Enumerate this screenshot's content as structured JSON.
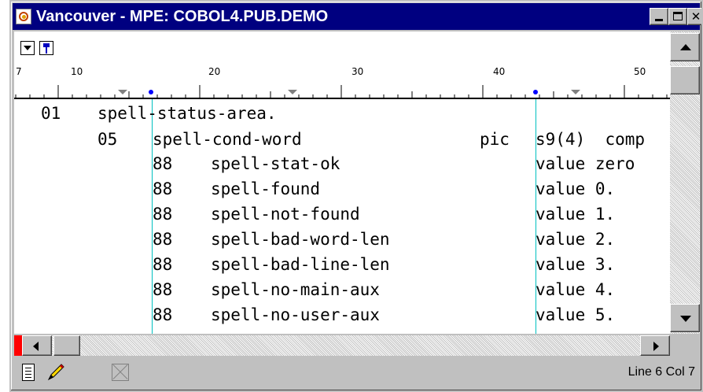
{
  "window": {
    "title": "Vancouver - MPE: COBOL4.PUB.DEMO",
    "controls": {
      "minimize_icon": "minimize-icon",
      "maximize_icon": "maximize-icon",
      "close_glyph": "✕"
    }
  },
  "toolbar": {
    "dropdown_icon": "dropdown-arrow-icon",
    "pin_icon": "pin-icon"
  },
  "ruler": {
    "labels": [
      "7",
      "10",
      "20",
      "30",
      "40",
      "50"
    ],
    "marker_colors": {
      "tab_stop": "#808080",
      "margin": "#0000ff"
    }
  },
  "code": {
    "lines": [
      {
        "level": "01",
        "name": "spell-status-area.",
        "clause": "",
        "value": ""
      },
      {
        "level": "05",
        "name": "spell-cond-word",
        "clause": "pic",
        "value": "s9(4)  comp"
      },
      {
        "level": "88",
        "name": "spell-stat-ok",
        "clause": "",
        "value": "value zero"
      },
      {
        "level": "88",
        "name": "spell-found",
        "clause": "",
        "value": "value 0."
      },
      {
        "level": "88",
        "name": "spell-not-found",
        "clause": "",
        "value": "value 1."
      },
      {
        "level": "88",
        "name": "spell-bad-word-len",
        "clause": "",
        "value": "value 2."
      },
      {
        "level": "88",
        "name": "spell-bad-line-len",
        "clause": "",
        "value": "value 3."
      },
      {
        "level": "88",
        "name": "spell-no-main-aux",
        "clause": "",
        "value": "value 4."
      },
      {
        "level": "88",
        "name": "spell-no-user-aux",
        "clause": "",
        "value": "value 5."
      }
    ],
    "guide_color": "#00c0c0"
  },
  "statusbar": {
    "position": "Line 6 Col 7",
    "icons": [
      "document-icon",
      "pencil-icon",
      "disabled-x-icon"
    ]
  },
  "colors": {
    "titlebar": "#000080",
    "window_face": "#c0c0c0",
    "marker": "#ff0000"
  }
}
